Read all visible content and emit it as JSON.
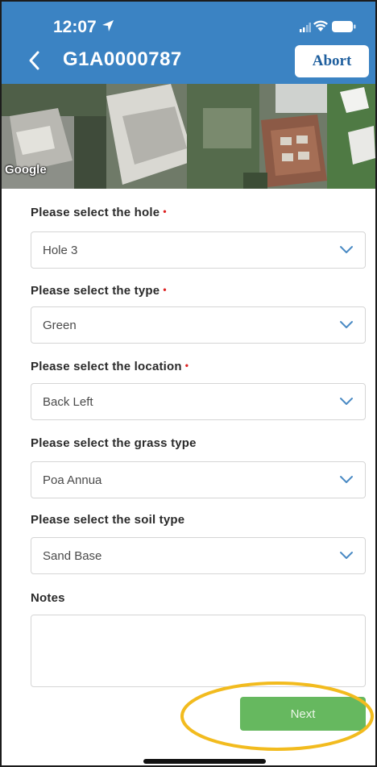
{
  "status_bar": {
    "time": "12:07"
  },
  "nav": {
    "title": "G1A0000787",
    "abort_label": "Abort"
  },
  "map": {
    "attribution": "Google"
  },
  "form": {
    "fields": [
      {
        "label": "Please select the hole",
        "required": true,
        "value": "Hole 3"
      },
      {
        "label": "Please select the type",
        "required": true,
        "value": "Green"
      },
      {
        "label": "Please select the location",
        "required": true,
        "value": "Back Left"
      },
      {
        "label": "Please select the grass type",
        "required": false,
        "value": "Poa Annua"
      },
      {
        "label": "Please select the soil type",
        "required": false,
        "value": "Sand Base"
      }
    ],
    "notes_label": "Notes",
    "notes_value": "",
    "next_label": "Next"
  },
  "colors": {
    "header": "#3b83c3",
    "required_asterisk": "#dd2222",
    "next_button": "#66b85f",
    "highlight_ring": "#f2bb1e"
  },
  "icons": [
    "location-arrow-icon",
    "signal-icon",
    "wifi-icon",
    "battery-icon",
    "chevron-left-icon",
    "chevron-down-icon"
  ]
}
